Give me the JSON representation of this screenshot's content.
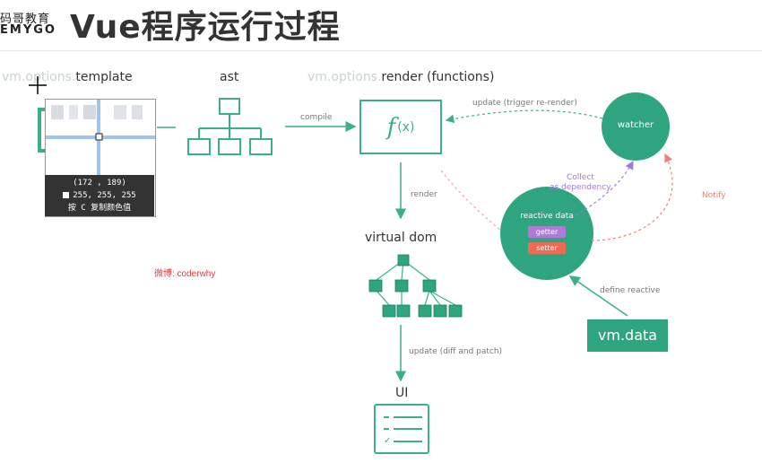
{
  "header": {
    "logo_top": "码哥教育",
    "logo_bottom": "EMYGO",
    "title": "Vue程序运行过程"
  },
  "diagram": {
    "template_prefix": "vm.options.",
    "template_label": "template",
    "ast_label": "ast",
    "compile_label": "compile",
    "render_prefix": "vm.options.",
    "render_label": "render (functions)",
    "function_symbol": "f",
    "function_arg": "(x)",
    "update_trigger_label": "update (trigger re-render)",
    "watcher_label": "watcher",
    "collect_label_1": "Collect",
    "collect_label_2": "as dependency",
    "notify_label": "Notify",
    "render_edge_label": "render",
    "reactive_data_label": "reactive data",
    "getter_label": "getter",
    "setter_label": "setter",
    "virtual_dom_label": "virtual dom",
    "define_reactive_label": "define reactive",
    "vm_data_label": "vm.data",
    "update_diff_label": "update (diff and patch)",
    "ui_label": "UI",
    "watermark": "微博: coderwhy",
    "colors": {
      "accent": "#3aaf8a",
      "getter": "#b07ad8",
      "setter": "#ef6a52",
      "notify": "#e8837a",
      "collect": "#a07ad8"
    }
  },
  "magnifier": {
    "coords": "(172 , 189)",
    "rgb": "255, 255, 255",
    "hint": "按 C 复制颜色值"
  }
}
